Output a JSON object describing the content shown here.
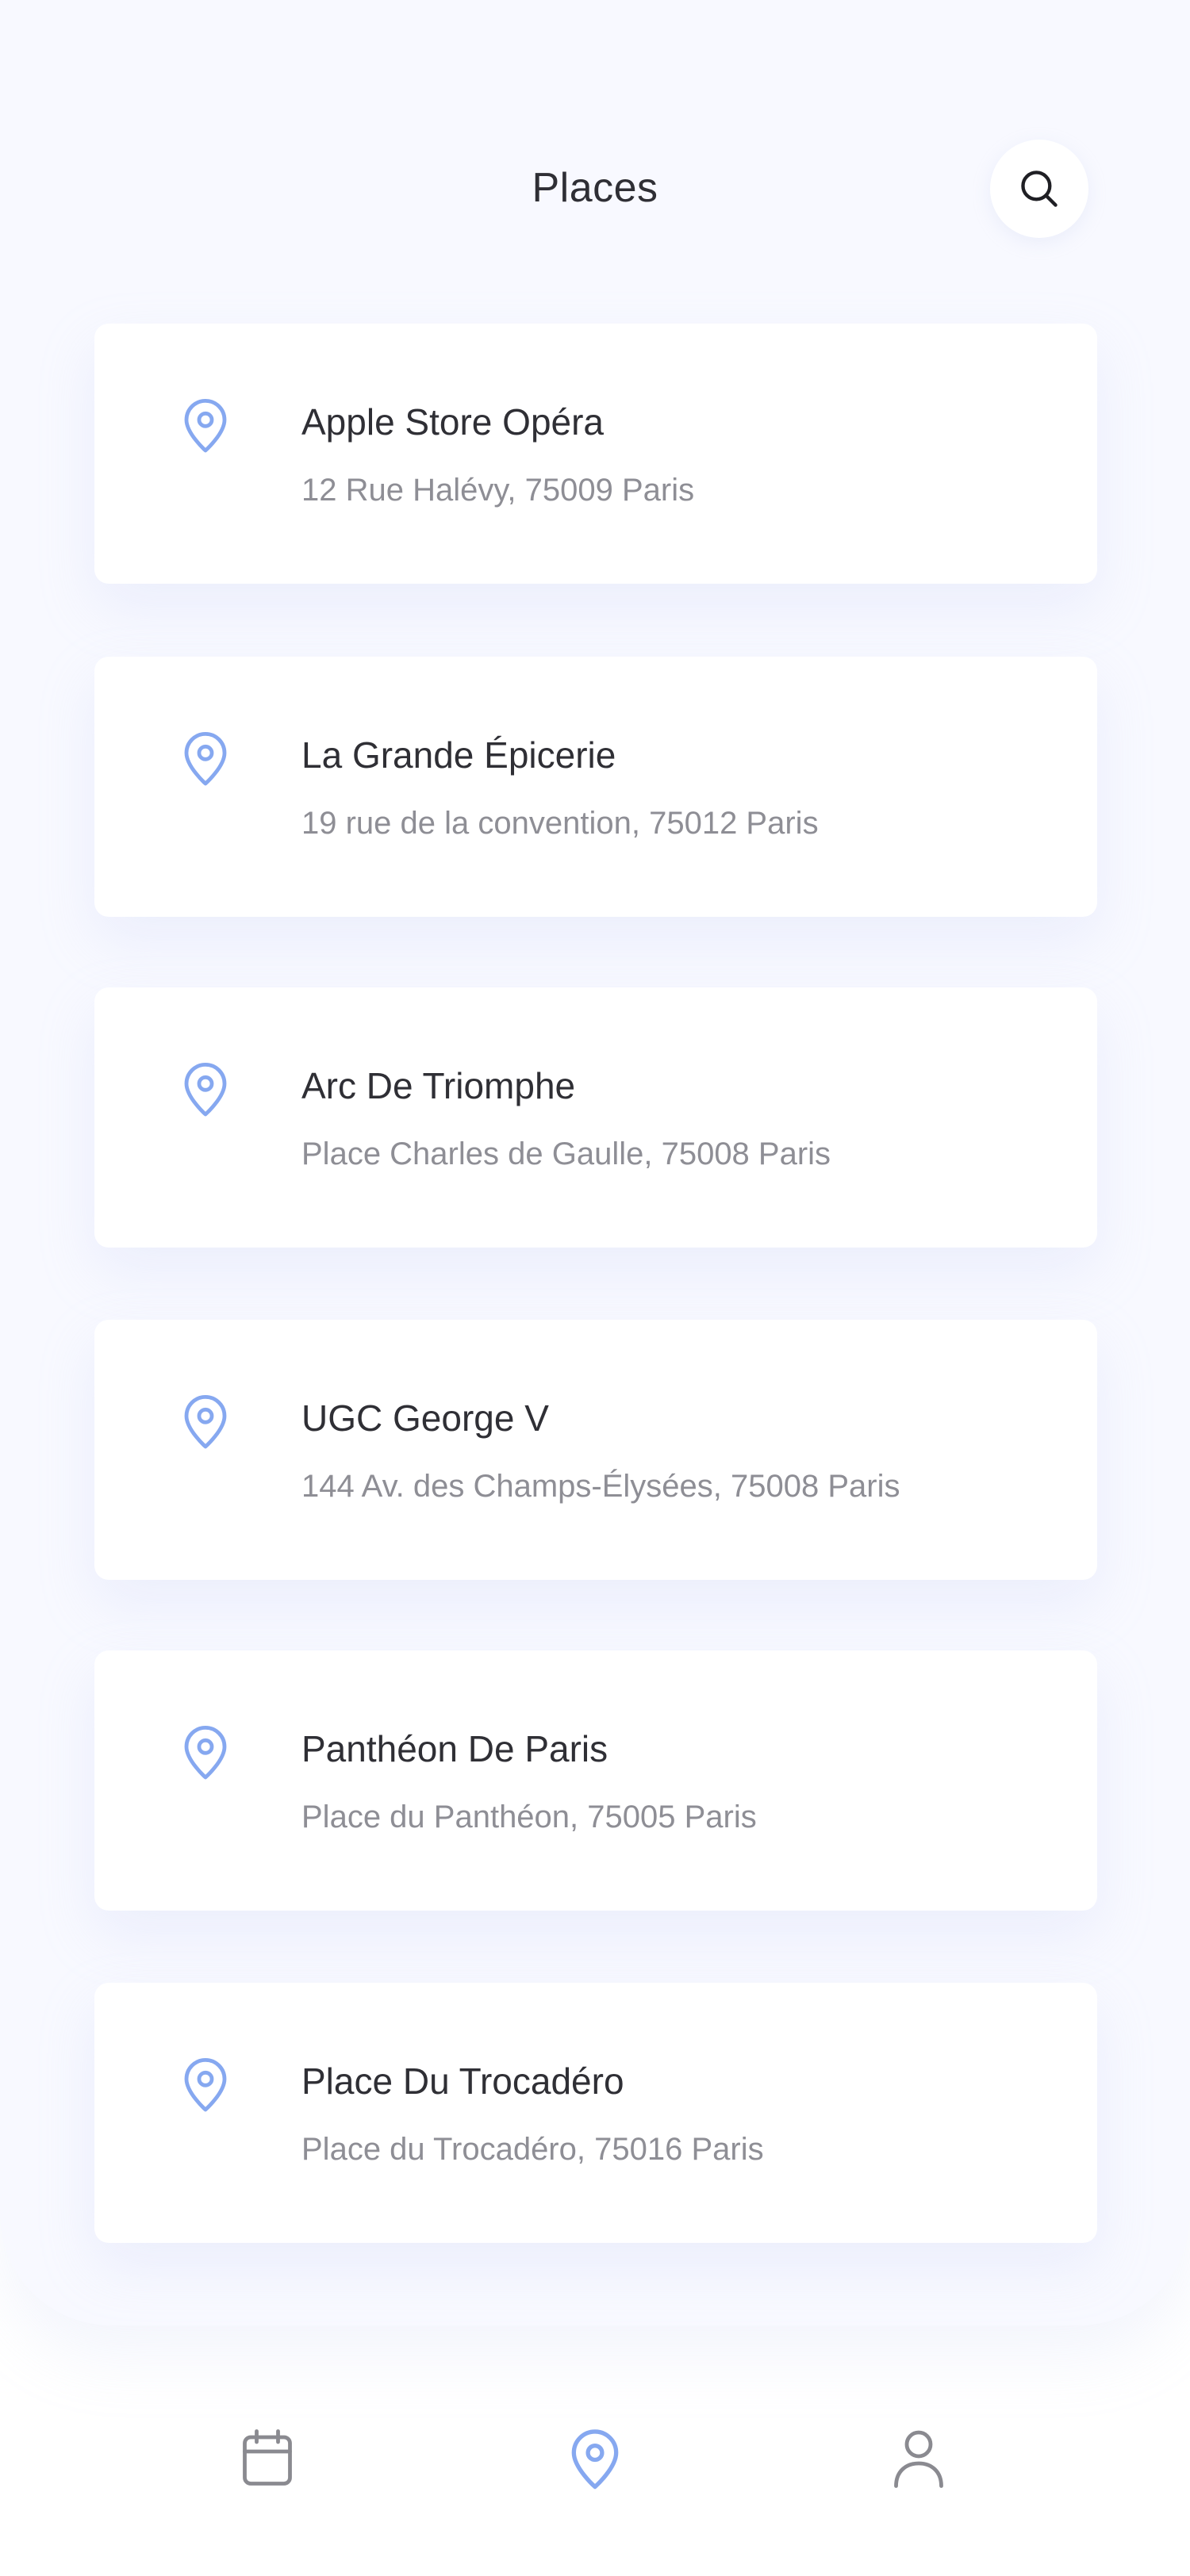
{
  "header": {
    "title": "Places",
    "search_icon": "search-icon"
  },
  "places": [
    {
      "name": "Apple Store Opéra",
      "address": "12 Rue Halévy, 75009 Paris",
      "icon": "map-pin-icon"
    },
    {
      "name": "La Grande Épicerie",
      "address": "19 rue de la convention, 75012 Paris",
      "icon": "map-pin-icon"
    },
    {
      "name": "Arc De Triomphe",
      "address": "Place Charles de Gaulle, 75008 Paris",
      "icon": "map-pin-icon"
    },
    {
      "name": "UGC George V",
      "address": "144 Av. des Champs-Élysées, 75008 Paris",
      "icon": "map-pin-icon"
    },
    {
      "name": "Panthéon De Paris",
      "address": "Place du Panthéon, 75005 Paris",
      "icon": "map-pin-icon"
    },
    {
      "name": "Place Du Trocadéro",
      "address": "Place du Trocadéro, 75016 Paris",
      "icon": "map-pin-icon"
    }
  ],
  "bottom_nav": {
    "items": [
      {
        "icon": "calendar-icon",
        "active": false
      },
      {
        "icon": "map-pin-icon",
        "active": true
      },
      {
        "icon": "user-icon",
        "active": false
      }
    ]
  },
  "colors": {
    "accent": "#86a8f0",
    "background": "#f8f9ff",
    "title_text": "#2f2f35",
    "secondary_text": "#8e8e95",
    "inactive_icon": "#8a8a90"
  }
}
